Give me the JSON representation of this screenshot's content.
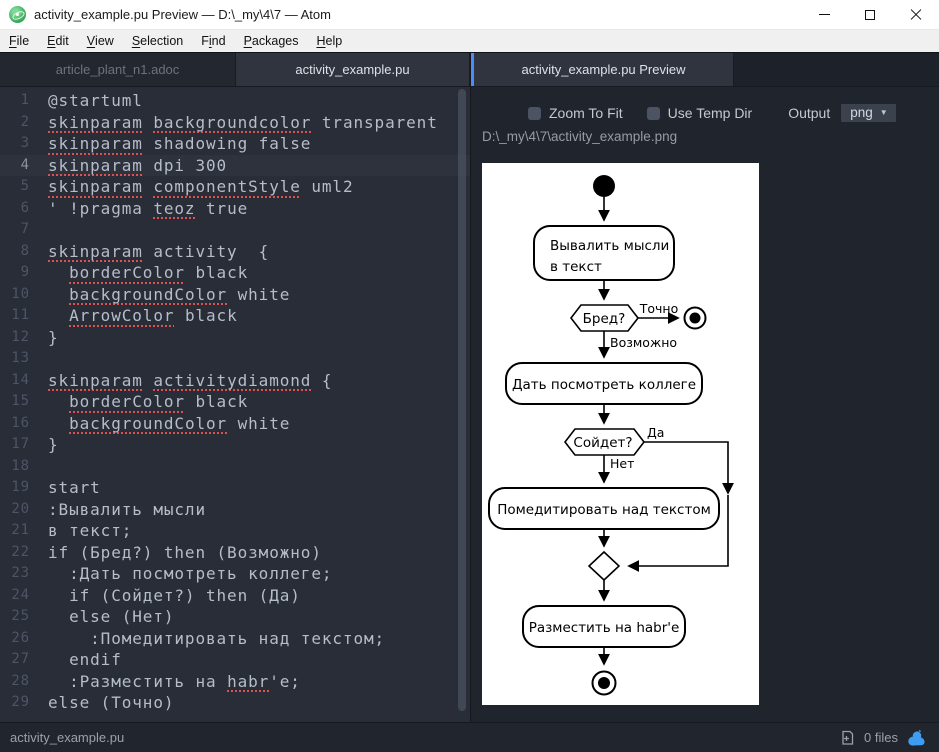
{
  "titlebar": {
    "title": "activity_example.pu Preview — D:\\_my\\4\\7 — Atom"
  },
  "menu": {
    "items": [
      {
        "label": "File",
        "u": 0
      },
      {
        "label": "Edit",
        "u": 0
      },
      {
        "label": "View",
        "u": 0
      },
      {
        "label": "Selection",
        "u": 0
      },
      {
        "label": "Find",
        "u": 1
      },
      {
        "label": "Packages",
        "u": 0
      },
      {
        "label": "Help",
        "u": 0
      }
    ]
  },
  "tabs": {
    "left": [
      {
        "label": "article_plant_n1.adoc",
        "active": false
      },
      {
        "label": "activity_example.pu",
        "active": true
      }
    ],
    "right": [
      {
        "label": "activity_example.pu Preview",
        "active": true
      }
    ]
  },
  "editor": {
    "active_line": 4,
    "lines": [
      [
        {
          "t": "@startuml"
        }
      ],
      [
        {
          "t": "skinparam",
          "m": true
        },
        {
          "t": " "
        },
        {
          "t": "backgroundcolor",
          "m": true
        },
        {
          "t": " transparent"
        }
      ],
      [
        {
          "t": "skinparam",
          "m": true
        },
        {
          "t": " shadowing false"
        }
      ],
      [
        {
          "t": "skinparam",
          "m": true
        },
        {
          "t": " dpi 300"
        }
      ],
      [
        {
          "t": "skinparam",
          "m": true
        },
        {
          "t": " "
        },
        {
          "t": "componentStyle",
          "m": true
        },
        {
          "t": " uml2"
        }
      ],
      [
        {
          "t": "' !pragma "
        },
        {
          "t": "teoz",
          "m": true
        },
        {
          "t": " true"
        }
      ],
      [],
      [
        {
          "t": "skinparam",
          "m": true
        },
        {
          "t": " activity  {"
        }
      ],
      [
        {
          "t": "  "
        },
        {
          "t": "borderColor",
          "m": true
        },
        {
          "t": " black"
        }
      ],
      [
        {
          "t": "  "
        },
        {
          "t": "backgroundColor",
          "m": true
        },
        {
          "t": " white"
        }
      ],
      [
        {
          "t": "  "
        },
        {
          "t": "ArrowColor",
          "m": true
        },
        {
          "t": " black"
        }
      ],
      [
        {
          "t": "}"
        }
      ],
      [],
      [
        {
          "t": "skinparam",
          "m": true
        },
        {
          "t": " "
        },
        {
          "t": "activitydiamond",
          "m": true
        },
        {
          "t": " {"
        }
      ],
      [
        {
          "t": "  "
        },
        {
          "t": "borderColor",
          "m": true
        },
        {
          "t": " black"
        }
      ],
      [
        {
          "t": "  "
        },
        {
          "t": "backgroundColor",
          "m": true
        },
        {
          "t": " white"
        }
      ],
      [
        {
          "t": "}"
        }
      ],
      [],
      [
        {
          "t": "start"
        }
      ],
      [
        {
          "t": ":Вывалить мысли"
        }
      ],
      [
        {
          "t": "в текст;"
        }
      ],
      [
        {
          "t": "if (Бред?) then (Возможно)"
        }
      ],
      [
        {
          "t": "  :Дать посмотреть коллеге;"
        }
      ],
      [
        {
          "t": "  if (Сойдет?) then (Да)"
        }
      ],
      [
        {
          "t": "  else (Нет)"
        }
      ],
      [
        {
          "t": "    :Помедитировать над текстом;"
        }
      ],
      [
        {
          "t": "  endif"
        }
      ],
      [
        {
          "t": "  :Разместить на "
        },
        {
          "t": "habr",
          "m": true
        },
        {
          "t": "'e;"
        }
      ],
      [
        {
          "t": "else (Точно)"
        }
      ]
    ]
  },
  "preview": {
    "zoom_to_fit_label": "Zoom To Fit",
    "use_temp_dir_label": "Use Temp Dir",
    "output_label": "Output",
    "output_value": "png",
    "image_path": "D:\\_my\\4\\7\\activity_example.png",
    "diagram": {
      "box1_line1": "Вывалить мысли",
      "box1_line2": "в текст",
      "decision1": "Бред?",
      "label_exact": "Точно",
      "label_maybe": "Возможно",
      "box2": "Дать посмотреть коллеге",
      "decision2": "Сойдет?",
      "label_yes": "Да",
      "label_no": "Нет",
      "box3": "Помедитировать над текстом",
      "box4": "Разместить на habr'e"
    }
  },
  "statusbar": {
    "file": "activity_example.pu",
    "files_count": "0 files"
  },
  "icons": {
    "dropdown_arrow": "▼",
    "minimize": "minus-shape",
    "maximize": "square-outline",
    "close": "x-shape",
    "file_add": "document-plus",
    "squirrel": "blue-squirrel"
  },
  "colors": {
    "accent_blue": "#4a8df8",
    "spellcheck_red": "#e0504c",
    "squirrel_blue": "#3f9cf3",
    "diagram_bg": "#ffffff",
    "diagram_stroke": "#000000"
  }
}
